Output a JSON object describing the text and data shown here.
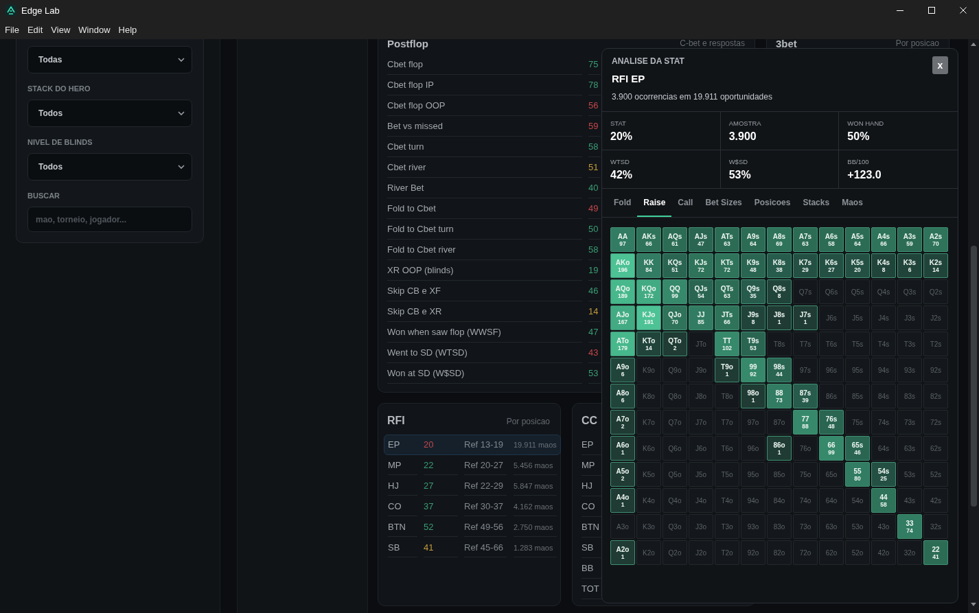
{
  "window": {
    "title": "Edge Lab"
  },
  "menu": [
    "File",
    "Edit",
    "View",
    "Window",
    "Help"
  ],
  "filters": [
    {
      "kind": "select",
      "value": "Todas"
    },
    {
      "kind": "select",
      "label": "STACK DO HERO",
      "value": "Todos"
    },
    {
      "kind": "select",
      "label": "NIVEL DE BLINDS",
      "value": "Todos"
    },
    {
      "kind": "search",
      "label": "BUSCAR",
      "placeholder": "mao, torneio, jogador..."
    }
  ],
  "postflop": {
    "title": "Postflop",
    "subtitle": "C-bet e respostas",
    "rows": [
      {
        "label": "Cbet flop",
        "value": "75",
        "color": "#3a9c74"
      },
      {
        "label": "Cbet flop IP",
        "value": "78",
        "color": "#3a9c74"
      },
      {
        "label": "Cbet flop OOP",
        "value": "56",
        "color": "#c2474b"
      },
      {
        "label": "Bet vs missed",
        "value": "59",
        "color": "#c2474b"
      },
      {
        "label": "Cbet turn",
        "value": "58",
        "color": "#3a9c74"
      },
      {
        "label": "Cbet river",
        "value": "51",
        "color": "#c0993d"
      },
      {
        "label": "River Bet",
        "value": "40",
        "color": "#3a9c74"
      },
      {
        "label": "Fold to Cbet",
        "value": "49",
        "color": "#c2474b"
      },
      {
        "label": "Fold to Cbet turn",
        "value": "50",
        "color": "#3a9c74"
      },
      {
        "label": "Fold to Cbet river",
        "value": "58",
        "color": "#3a9c74"
      },
      {
        "label": "XR OOP (blinds)",
        "value": "19",
        "color": "#3a9c74"
      },
      {
        "label": "Skip CB e XF",
        "value": "46",
        "color": "#3a9c74"
      },
      {
        "label": "Skip CB e XR",
        "value": "14",
        "color": "#c0993d"
      },
      {
        "label": "Won when saw flop (WWSF)",
        "value": "47",
        "color": "#3a9c74"
      },
      {
        "label": "Went to SD (WTSD)",
        "value": "43",
        "color": "#c2474b"
      },
      {
        "label": "Won at SD (W$SD)",
        "value": "53",
        "color": "#3a9c74"
      }
    ]
  },
  "threebet": {
    "title": "3bet",
    "subtitle": "Por posicao"
  },
  "rfi": {
    "title": "RFI",
    "subtitle": "Por posicao",
    "rows": [
      {
        "position": "EP",
        "value": "20",
        "color": "#c2474b",
        "reference": "Ref 13-19",
        "hands": "19.911 maos",
        "selected": true
      },
      {
        "position": "MP",
        "value": "22",
        "color": "#3a9c74",
        "reference": "Ref 20-27",
        "hands": "5.456 maos",
        "selected": false
      },
      {
        "position": "HJ",
        "value": "27",
        "color": "#3a9c74",
        "reference": "Ref 22-29",
        "hands": "5.847 maos",
        "selected": false
      },
      {
        "position": "CO",
        "value": "37",
        "color": "#3a9c74",
        "reference": "Ref 30-37",
        "hands": "4.162 maos",
        "selected": false
      },
      {
        "position": "BTN",
        "value": "52",
        "color": "#3a9c74",
        "reference": "Ref 49-56",
        "hands": "2.750 maos",
        "selected": false
      },
      {
        "position": "SB",
        "value": "41",
        "color": "#c0993d",
        "reference": "Ref 45-66",
        "hands": "1.283 maos",
        "selected": false
      }
    ]
  },
  "cc": {
    "title": "CC",
    "positions": [
      "EP",
      "MP",
      "HJ",
      "CO",
      "BTN",
      "SB",
      "BB",
      "TOT"
    ]
  },
  "analysis": {
    "heading": "ANALISE DA STAT",
    "title": "RFI EP",
    "summary": "3.900 ocorrencias em 19.911 oportunidades",
    "close": "x",
    "stats": [
      {
        "label": "STAT",
        "value": "20%"
      },
      {
        "label": "AMOSTRA",
        "value": "3.900"
      },
      {
        "label": "WON HAND",
        "value": "50%"
      },
      {
        "label": "WTSD",
        "value": "42%"
      },
      {
        "label": "W$SD",
        "value": "53%"
      },
      {
        "label": "BB/100",
        "value": "+123.0"
      }
    ],
    "tabs": [
      {
        "label": "Fold",
        "selected": false
      },
      {
        "label": "Raise",
        "selected": true
      },
      {
        "label": "Call",
        "selected": false
      },
      {
        "label": "Bet Sizes",
        "selected": false
      },
      {
        "label": "Posicoes",
        "selected": false
      },
      {
        "label": "Stacks",
        "selected": false
      },
      {
        "label": "Maos",
        "selected": false
      }
    ],
    "hand_grid": [
      {
        "cells": [
          {
            "hand": "AA",
            "count": "97",
            "color": "#317c62"
          },
          {
            "hand": "AKs",
            "count": "66",
            "color": "#2e735a"
          },
          {
            "hand": "AQs",
            "count": "61",
            "color": "#2c6c55"
          },
          {
            "hand": "AJs",
            "count": "47",
            "color": "#2a6552"
          },
          {
            "hand": "ATs",
            "count": "63",
            "color": "#2c6c55"
          },
          {
            "hand": "A9s",
            "count": "64",
            "color": "#2c6c55"
          },
          {
            "hand": "A8s",
            "count": "69",
            "color": "#2e735a"
          },
          {
            "hand": "A7s",
            "count": "63",
            "color": "#2c6c55"
          },
          {
            "hand": "A6s",
            "count": "58",
            "color": "#2c6c55"
          },
          {
            "hand": "A5s",
            "count": "64",
            "color": "#2c6c55"
          },
          {
            "hand": "A4s",
            "count": "66",
            "color": "#2e735a"
          },
          {
            "hand": "A3s",
            "count": "59",
            "color": "#2c6c55"
          },
          {
            "hand": "A2s",
            "count": "70",
            "color": "#2e735a"
          }
        ]
      },
      {
        "cells": [
          {
            "hand": "AKo",
            "count": "196",
            "color": "#4cc295"
          },
          {
            "hand": "KK",
            "count": "84",
            "color": "#317c62"
          },
          {
            "hand": "KQs",
            "count": "51",
            "color": "#2a6552"
          },
          {
            "hand": "KJs",
            "count": "72",
            "color": "#2e735a"
          },
          {
            "hand": "KTs",
            "count": "72",
            "color": "#2e735a"
          },
          {
            "hand": "K9s",
            "count": "48",
            "color": "#2a6552"
          },
          {
            "hand": "K8s",
            "count": "38",
            "color": "#275b4b"
          },
          {
            "hand": "K7s",
            "count": "29",
            "color": "#245043"
          },
          {
            "hand": "K6s",
            "count": "27",
            "color": "#245043"
          },
          {
            "hand": "K5s",
            "count": "20",
            "color": "#245043"
          },
          {
            "hand": "K4s",
            "count": "8",
            "color": "#21443a"
          },
          {
            "hand": "K3s",
            "count": "6",
            "color": "#21443a"
          },
          {
            "hand": "K2s",
            "count": "14",
            "color": "#21443a"
          }
        ]
      },
      {
        "cells": [
          {
            "hand": "AQo",
            "count": "189",
            "color": "#47b88c"
          },
          {
            "hand": "KQo",
            "count": "172",
            "color": "#42ab83"
          },
          {
            "hand": "QQ",
            "count": "99",
            "color": "#36896b"
          },
          {
            "hand": "QJs",
            "count": "54",
            "color": "#2a6552"
          },
          {
            "hand": "QTs",
            "count": "63",
            "color": "#2c6c55"
          },
          {
            "hand": "Q9s",
            "count": "35",
            "color": "#275b4b"
          },
          {
            "hand": "Q8s",
            "count": "8",
            "color": "#21443a"
          },
          {
            "hand": "Q7s"
          },
          {
            "hand": "Q6s"
          },
          {
            "hand": "Q5s"
          },
          {
            "hand": "Q4s"
          },
          {
            "hand": "Q3s"
          },
          {
            "hand": "Q2s"
          }
        ]
      },
      {
        "cells": [
          {
            "hand": "AJo",
            "count": "167",
            "color": "#42ab83"
          },
          {
            "hand": "KJo",
            "count": "191",
            "color": "#4cc295"
          },
          {
            "hand": "QJo",
            "count": "70",
            "color": "#2e735a"
          },
          {
            "hand": "JJ",
            "count": "85",
            "color": "#317c62"
          },
          {
            "hand": "JTs",
            "count": "66",
            "color": "#2e735a"
          },
          {
            "hand": "J9s",
            "count": "8",
            "color": "#21443a"
          },
          {
            "hand": "J8s",
            "count": "1",
            "color": "#1f3b33"
          },
          {
            "hand": "J7s",
            "count": "1",
            "color": "#1f3b33"
          },
          {
            "hand": "J6s"
          },
          {
            "hand": "J5s"
          },
          {
            "hand": "J4s"
          },
          {
            "hand": "J3s"
          },
          {
            "hand": "J2s"
          }
        ]
      },
      {
        "cells": [
          {
            "hand": "ATo",
            "count": "179",
            "color": "#47b88c"
          },
          {
            "hand": "KTo",
            "count": "14",
            "color": "#21443a"
          },
          {
            "hand": "QTo",
            "count": "2",
            "color": "#1f3b33"
          },
          {
            "hand": "JTo"
          },
          {
            "hand": "TT",
            "count": "102",
            "color": "#36896b"
          },
          {
            "hand": "T9s",
            "count": "53",
            "color": "#2a6552"
          },
          {
            "hand": "T8s"
          },
          {
            "hand": "T7s"
          },
          {
            "hand": "T6s"
          },
          {
            "hand": "T5s"
          },
          {
            "hand": "T4s"
          },
          {
            "hand": "T3s"
          },
          {
            "hand": "T2s"
          }
        ]
      },
      {
        "cells": [
          {
            "hand": "A9o",
            "count": "6",
            "color": "#21443a"
          },
          {
            "hand": "K9o"
          },
          {
            "hand": "Q9o"
          },
          {
            "hand": "J9o"
          },
          {
            "hand": "T9o",
            "count": "1",
            "color": "#1f3b33"
          },
          {
            "hand": "99",
            "count": "92",
            "color": "#36896b"
          },
          {
            "hand": "98s",
            "count": "44",
            "color": "#2a6552"
          },
          {
            "hand": "97s"
          },
          {
            "hand": "96s"
          },
          {
            "hand": "95s"
          },
          {
            "hand": "94s"
          },
          {
            "hand": "93s"
          },
          {
            "hand": "92s"
          }
        ]
      },
      {
        "cells": [
          {
            "hand": "A8o",
            "count": "6",
            "color": "#21443a"
          },
          {
            "hand": "K8o"
          },
          {
            "hand": "Q8o"
          },
          {
            "hand": "J8o"
          },
          {
            "hand": "T8o"
          },
          {
            "hand": "98o",
            "count": "1",
            "color": "#1f3b33"
          },
          {
            "hand": "88",
            "count": "73",
            "color": "#317c62"
          },
          {
            "hand": "87s",
            "count": "39",
            "color": "#275b4b"
          },
          {
            "hand": "86s"
          },
          {
            "hand": "85s"
          },
          {
            "hand": "84s"
          },
          {
            "hand": "83s"
          },
          {
            "hand": "82s"
          }
        ]
      },
      {
        "cells": [
          {
            "hand": "A7o",
            "count": "2",
            "color": "#1f3b33"
          },
          {
            "hand": "K7o"
          },
          {
            "hand": "Q7o"
          },
          {
            "hand": "J7o"
          },
          {
            "hand": "T7o"
          },
          {
            "hand": "97o"
          },
          {
            "hand": "87o"
          },
          {
            "hand": "77",
            "count": "88",
            "color": "#36896b"
          },
          {
            "hand": "76s",
            "count": "48",
            "color": "#2a6552"
          },
          {
            "hand": "75s"
          },
          {
            "hand": "74s"
          },
          {
            "hand": "73s"
          },
          {
            "hand": "72s"
          }
        ]
      },
      {
        "cells": [
          {
            "hand": "A6o",
            "count": "1",
            "color": "#1f3b33"
          },
          {
            "hand": "K6o"
          },
          {
            "hand": "Q6o"
          },
          {
            "hand": "J6o"
          },
          {
            "hand": "T6o"
          },
          {
            "hand": "96o"
          },
          {
            "hand": "86o",
            "count": "1",
            "color": "#1f3b33"
          },
          {
            "hand": "76o"
          },
          {
            "hand": "66",
            "count": "99",
            "color": "#36896b"
          },
          {
            "hand": "65s",
            "count": "46",
            "color": "#2a6552"
          },
          {
            "hand": "64s"
          },
          {
            "hand": "63s"
          },
          {
            "hand": "62s"
          }
        ]
      },
      {
        "cells": [
          {
            "hand": "A5o",
            "count": "2",
            "color": "#1f3b33"
          },
          {
            "hand": "K5o"
          },
          {
            "hand": "Q5o"
          },
          {
            "hand": "J5o"
          },
          {
            "hand": "T5o"
          },
          {
            "hand": "95o"
          },
          {
            "hand": "85o"
          },
          {
            "hand": "75o"
          },
          {
            "hand": "65o"
          },
          {
            "hand": "55",
            "count": "80",
            "color": "#317c62"
          },
          {
            "hand": "54s",
            "count": "25",
            "color": "#245043"
          },
          {
            "hand": "53s"
          },
          {
            "hand": "52s"
          }
        ]
      },
      {
        "cells": [
          {
            "hand": "A4o",
            "count": "1",
            "color": "#1f3b33"
          },
          {
            "hand": "K4o"
          },
          {
            "hand": "Q4o"
          },
          {
            "hand": "J4o"
          },
          {
            "hand": "T4o"
          },
          {
            "hand": "94o"
          },
          {
            "hand": "84o"
          },
          {
            "hand": "74o"
          },
          {
            "hand": "64o"
          },
          {
            "hand": "54o"
          },
          {
            "hand": "44",
            "count": "58",
            "color": "#2e735a"
          },
          {
            "hand": "43s"
          },
          {
            "hand": "42s"
          }
        ]
      },
      {
        "cells": [
          {
            "hand": "A3o"
          },
          {
            "hand": "K3o"
          },
          {
            "hand": "Q3o"
          },
          {
            "hand": "J3o"
          },
          {
            "hand": "T3o"
          },
          {
            "hand": "93o"
          },
          {
            "hand": "83o"
          },
          {
            "hand": "73o"
          },
          {
            "hand": "63o"
          },
          {
            "hand": "53o"
          },
          {
            "hand": "43o"
          },
          {
            "hand": "33",
            "count": "74",
            "color": "#317c62"
          },
          {
            "hand": "32s"
          }
        ]
      },
      {
        "cells": [
          {
            "hand": "A2o",
            "count": "1",
            "color": "#1f3b33"
          },
          {
            "hand": "K2o"
          },
          {
            "hand": "Q2o"
          },
          {
            "hand": "J2o"
          },
          {
            "hand": "T2o"
          },
          {
            "hand": "92o"
          },
          {
            "hand": "82o"
          },
          {
            "hand": "72o"
          },
          {
            "hand": "62o"
          },
          {
            "hand": "52o"
          },
          {
            "hand": "42o"
          },
          {
            "hand": "32o"
          },
          {
            "hand": "22",
            "count": "41",
            "color": "#2c6c55"
          }
        ]
      }
    ]
  }
}
